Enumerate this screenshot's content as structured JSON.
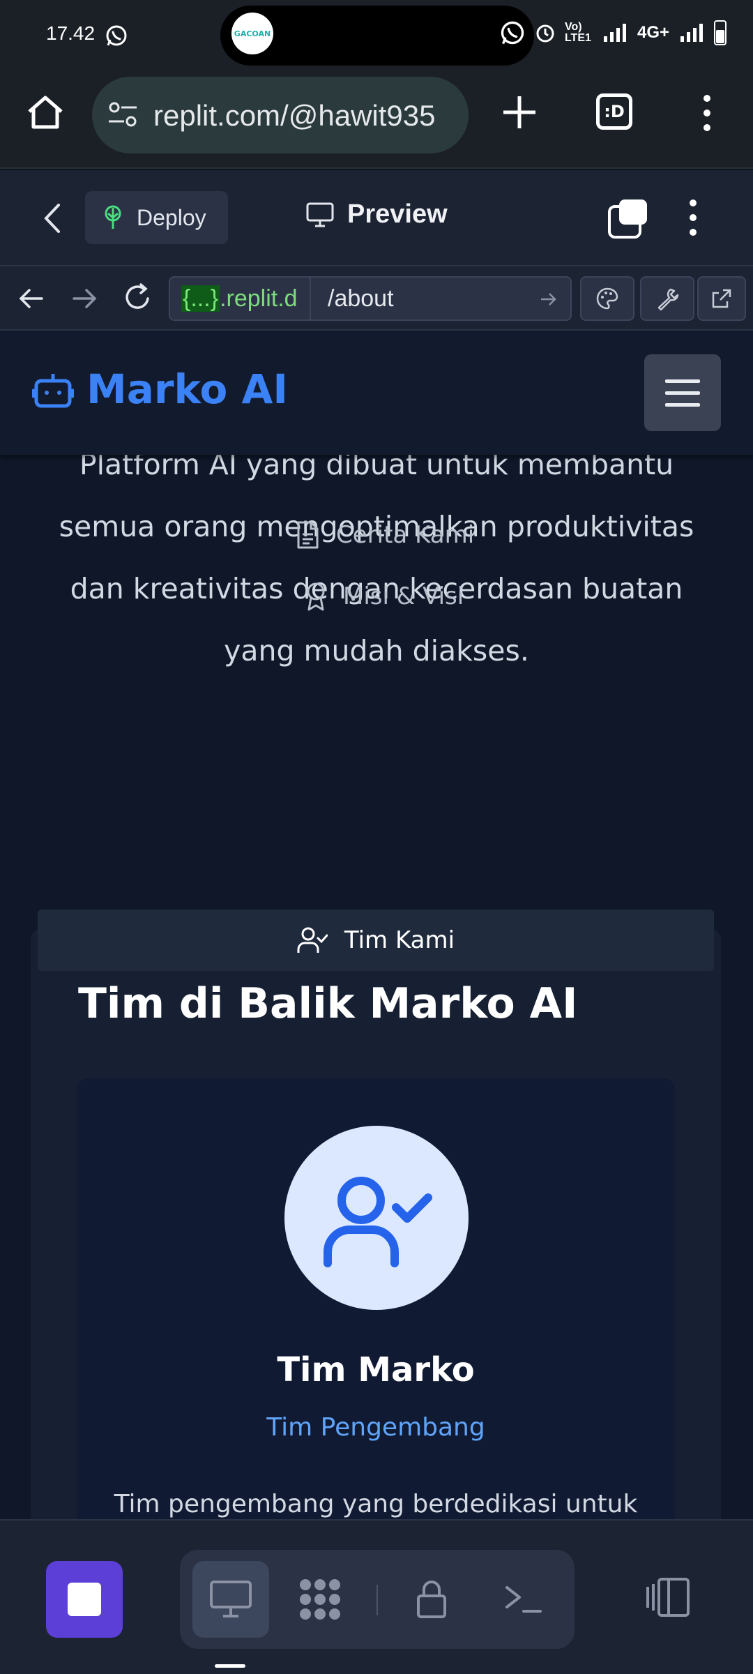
{
  "status_bar": {
    "time": "17.42",
    "pill_avatar_text": "GACOAN",
    "network": "4G+",
    "volte": "Vo) LTE1"
  },
  "browser": {
    "url": "replit.com/@hawit935",
    "tabs_label": ":D"
  },
  "replit_header": {
    "deploy_label": "Deploy",
    "preview_label": "Preview"
  },
  "devtools": {
    "host_brace": "{...}",
    "host_rest": ".replit.d",
    "path": "/about"
  },
  "site": {
    "brand": "Marko AI",
    "intro": "Platform AI yang dibuat untuk membantu semua orang mengoptimalkan produktivitas dan kreativitas dengan kecerdasan buatan yang mudah diakses.",
    "tabs": [
      {
        "label": "Cerita Kami",
        "icon": "document-icon",
        "active": false
      },
      {
        "label": "Misi & Visi",
        "icon": "award-icon",
        "active": false
      },
      {
        "label": "Tim Kami",
        "icon": "user-check-icon",
        "active": true
      }
    ],
    "team_heading": "Tim di Balik Marko AI",
    "member": {
      "name": "Tim Marko",
      "role": "Tim Pengembang",
      "description": "Tim pengembang yang berdedikasi untuk"
    }
  },
  "colors": {
    "brand_blue": "#3b82f6",
    "role_blue": "#60a5fa",
    "stop_purple": "#5b3fd6",
    "avatar_bg": "#dbe8ff"
  }
}
